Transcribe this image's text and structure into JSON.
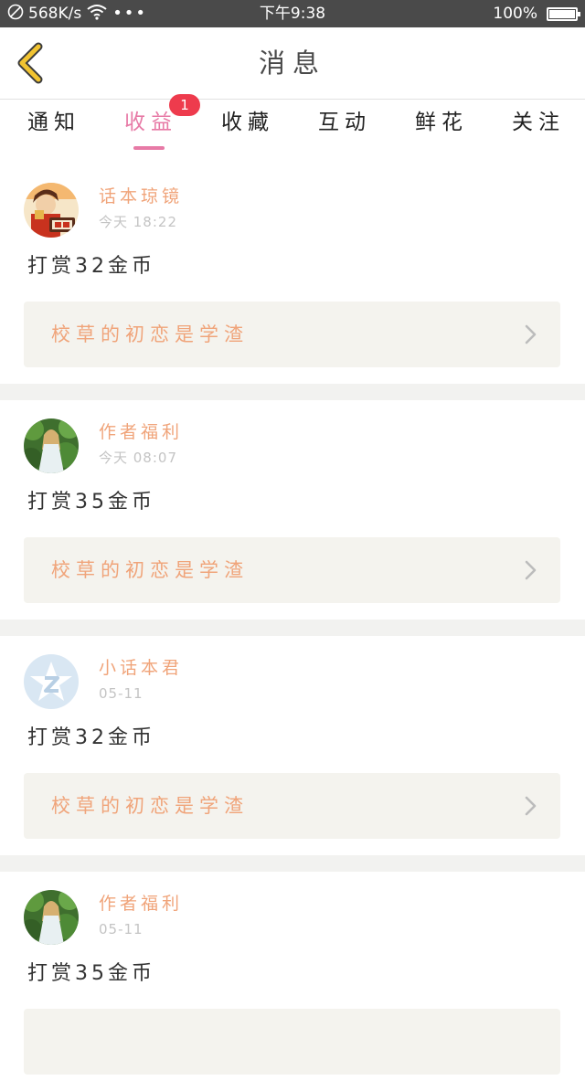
{
  "status_bar": {
    "network_speed": "568K/s",
    "time": "下午9:38",
    "battery_percent": "100%",
    "battery_level": 1.0
  },
  "header": {
    "title": "消息"
  },
  "tabs": [
    {
      "label": "通知",
      "active": false
    },
    {
      "label": "收益",
      "active": true,
      "badge": "1"
    },
    {
      "label": "收藏",
      "active": false
    },
    {
      "label": "互动",
      "active": false
    },
    {
      "label": "鲜花",
      "active": false
    },
    {
      "label": "关注",
      "active": false
    }
  ],
  "colors": {
    "accent_pink": "#e77aa6",
    "username_orange": "#f0a47a",
    "badge_red": "#ee3b4d",
    "card_bg": "#f4f3ee"
  },
  "feed": [
    {
      "avatar_icon": "avatar-huabenlanjing",
      "username": "话本琼镜",
      "time": "今天 18:22",
      "message": "打赏32金币",
      "book_title": "校草的初恋是学渣"
    },
    {
      "avatar_icon": "avatar-girl-forest",
      "username": "作者福利",
      "time": "今天 08:07",
      "message": "打赏35金币",
      "book_title": "校草的初恋是学渣"
    },
    {
      "avatar_icon": "avatar-z-star",
      "username": "小话本君",
      "time": "05-11",
      "message": "打赏32金币",
      "book_title": "校草的初恋是学渣"
    },
    {
      "avatar_icon": "avatar-girl-forest",
      "username": "作者福利",
      "time": "05-11",
      "message": "打赏35金币",
      "book_title": ""
    }
  ]
}
